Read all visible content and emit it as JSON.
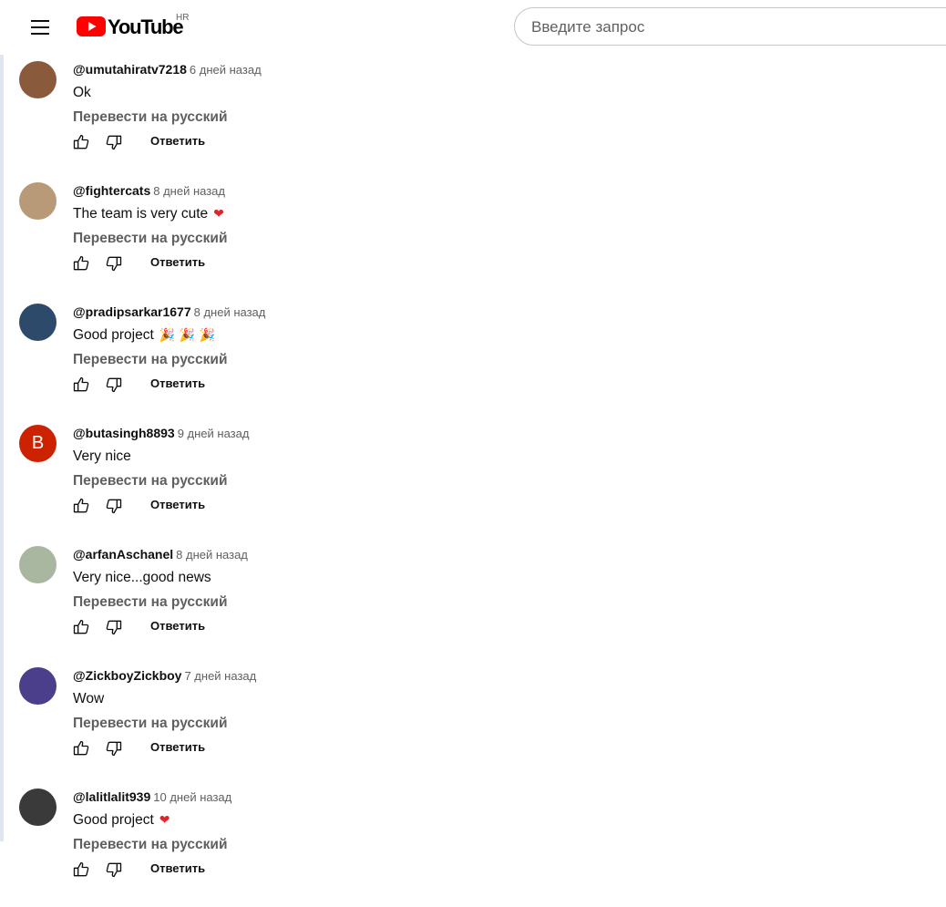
{
  "header": {
    "logo_text": "YouTube",
    "country_code": "HR",
    "search_placeholder": "Введите запрос"
  },
  "comments": [
    {
      "author": "@umutahiratv7218",
      "time": "6 дней назад",
      "text": "Ok",
      "emoji": "",
      "translate": "Перевести на русский",
      "reply": "Ответить",
      "avatar_color": "#8a5a3c",
      "avatar_letter": ""
    },
    {
      "author": "@fightercats",
      "time": "8 дней назад",
      "text": "The team is very cute",
      "emoji": "❤",
      "translate": "Перевести на русский",
      "reply": "Ответить",
      "avatar_color": "#b99a78",
      "avatar_letter": ""
    },
    {
      "author": "@pradipsarkar1677",
      "time": "8 дней назад",
      "text": "Good project",
      "emoji": "🎉 🎉 🎉",
      "translate": "Перевести на русский",
      "reply": "Ответить",
      "avatar_color": "#2d4a6b",
      "avatar_letter": ""
    },
    {
      "author": "@butasingh8893",
      "time": "9 дней назад",
      "text": "Very nice",
      "emoji": "",
      "translate": "Перевести на русский",
      "reply": "Ответить",
      "avatar_color": "#cc2200",
      "avatar_letter": "B"
    },
    {
      "author": "@arfanAschanel",
      "time": "8 дней назад",
      "text": "Very nice...good news",
      "emoji": "",
      "translate": "Перевести на русский",
      "reply": "Ответить",
      "avatar_color": "#a9b6a0",
      "avatar_letter": ""
    },
    {
      "author": "@ZickboyZickboy",
      "time": "7 дней назад",
      "text": "Wow",
      "emoji": "",
      "translate": "Перевести на русский",
      "reply": "Ответить",
      "avatar_color": "#4b3f8c",
      "avatar_letter": ""
    },
    {
      "author": "@lalitlalit939",
      "time": "10 дней назад",
      "text": "Good project",
      "emoji": "❤",
      "translate": "Перевести на русский",
      "reply": "Ответить",
      "avatar_color": "#3a3a3a",
      "avatar_letter": ""
    }
  ]
}
